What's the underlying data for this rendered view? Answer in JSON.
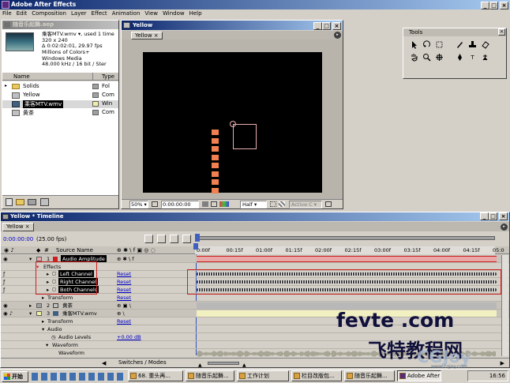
{
  "app": {
    "title": "Adobe After Effects"
  },
  "menu": [
    "File",
    "Edit",
    "Composition",
    "Layer",
    "Effect",
    "Animation",
    "View",
    "Window",
    "Help"
  ],
  "project": {
    "title": "随音乐起舞.aep",
    "info": [
      "乘客MTV.wmv ▾, used 1 time",
      "320 x 240",
      "Δ 0:02:02:01, 29.97 fps",
      "Millions of Colors+",
      "Windows Media",
      "48.000 kHz / 16 bit / Ster"
    ],
    "col_name": "Name",
    "col_type": "Type",
    "items": [
      {
        "name": "Solids",
        "type": "Fol"
      },
      {
        "name": "Yellow",
        "type": "Com"
      },
      {
        "name": "乘客MTV.wmv",
        "type": "Win"
      },
      {
        "name": "黄茶",
        "type": "Com"
      }
    ]
  },
  "comp": {
    "title": "Yellow",
    "tab": "Yellow",
    "zoom": "50%",
    "timecode": "0:00:00:00",
    "res": "Half",
    "camera": "Active C"
  },
  "tools": {
    "title": "Tools"
  },
  "timeline": {
    "title": "Yellow * Timeline",
    "tab": "Yellow",
    "time": "0:00:00:00",
    "fps": "(25.00 fps)",
    "col_source": "Source Name",
    "ruler": [
      "0:00f",
      "00:15f",
      "01:00f",
      "01:15f",
      "02:00f",
      "02:15f",
      "03:00f",
      "03:15f",
      "04:00f",
      "04:15f",
      "05:0"
    ],
    "layers": [
      {
        "num": "1",
        "name": "Audio Amplitude"
      },
      {
        "label": "Effects"
      },
      {
        "name": "Left Channel",
        "action": "Reset"
      },
      {
        "name": "Right Channel",
        "action": "Reset"
      },
      {
        "name": "Both Channels",
        "action": "Reset"
      },
      {
        "label": "Transform",
        "action": "Reset"
      },
      {
        "num": "2",
        "name": "黄茶"
      },
      {
        "num": "3",
        "name": "乘客MTV.wmv"
      },
      {
        "label": "Transform",
        "action": "Reset"
      },
      {
        "label": "Audio"
      },
      {
        "label": "Audio Levels",
        "value": "+0.00 dB"
      },
      {
        "label": "Waveform"
      },
      {
        "label": "Waveform"
      }
    ],
    "footer": "Switches / Modes"
  },
  "watermark": {
    "line1": "fevte .com",
    "line2": "飞特教程网",
    "site": "www.cgjoy.com",
    "logo": "CGJoy"
  },
  "taskbar": {
    "start": "开始",
    "items": [
      "68. 重头再...",
      "随音乐起舞...",
      "工作计划",
      "栏目改版包...",
      "随音乐起舞...",
      "Adobe After ..."
    ],
    "clock": "16:56"
  },
  "colors": {
    "orange": "#f08050",
    "titlebar": "#0a246a",
    "audio_bar": "#e8a8a8",
    "audio_red": "#cc2020",
    "wave": "#7a7a60"
  }
}
